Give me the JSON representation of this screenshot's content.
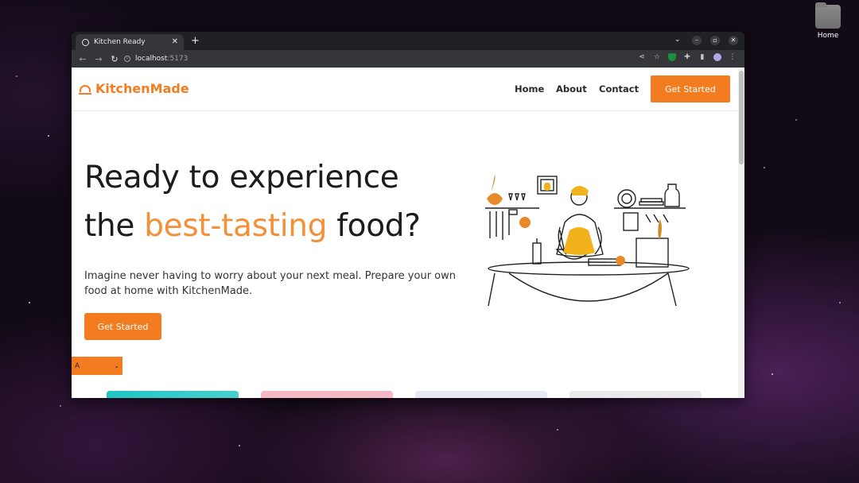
{
  "desktop": {
    "home_icon_label": "Home"
  },
  "browser": {
    "tab_title": "Kitchen Ready",
    "url_host": "localhost",
    "url_port": ":5173"
  },
  "site": {
    "brand": "KitchenMade",
    "nav": [
      "Home",
      "About",
      "Contact"
    ],
    "header_cta": "Get Started",
    "hero": {
      "line1": "Ready to experience",
      "line2_prefix": "the ",
      "line2_accent": "best-tasting",
      "line2_suffix": " food?",
      "description": "Imagine never having to worry about your next meal. Prepare your own food at home with KitchenMade.",
      "cta": "Get Started"
    },
    "select_value": "A"
  },
  "colors": {
    "accent": "#f47c20",
    "card_colors": [
      "#2ec8c4",
      "#f4b9c4",
      "#e6ebf3",
      "#e9e9ec"
    ]
  }
}
